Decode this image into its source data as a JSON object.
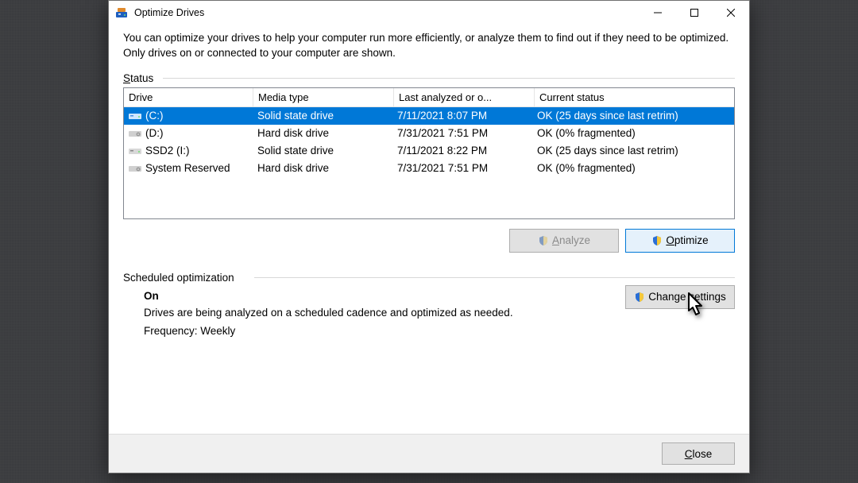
{
  "window": {
    "title": "Optimize Drives"
  },
  "intro": "You can optimize your drives to help your computer run more efficiently, or analyze them to find out if they need to be optimized. Only drives on or connected to your computer are shown.",
  "status_label": "Status",
  "columns": {
    "drive": "Drive",
    "media": "Media type",
    "last": "Last analyzed or o...",
    "status": "Current status"
  },
  "drives": [
    {
      "name": "(C:)",
      "media": "Solid state drive",
      "last": "7/11/2021 8:07 PM",
      "status": "OK (25 days since last retrim)",
      "selected": true,
      "icon": "ssd"
    },
    {
      "name": "(D:)",
      "media": "Hard disk drive",
      "last": "7/31/2021 7:51 PM",
      "status": "OK (0% fragmented)",
      "selected": false,
      "icon": "hdd"
    },
    {
      "name": "SSD2 (I:)",
      "media": "Solid state drive",
      "last": "7/11/2021 8:22 PM",
      "status": "OK (25 days since last retrim)",
      "selected": false,
      "icon": "ssd"
    },
    {
      "name": "System Reserved",
      "media": "Hard disk drive",
      "last": "7/31/2021 7:51 PM",
      "status": "OK (0% fragmented)",
      "selected": false,
      "icon": "hdd"
    }
  ],
  "buttons": {
    "analyze": "Analyze",
    "optimize": "Optimize",
    "change_settings": "Change settings",
    "close": "Close"
  },
  "scheduled": {
    "label": "Scheduled optimization",
    "state": "On",
    "desc": "Drives are being analyzed on a scheduled cadence and optimized as needed.",
    "freq": "Frequency: Weekly"
  }
}
